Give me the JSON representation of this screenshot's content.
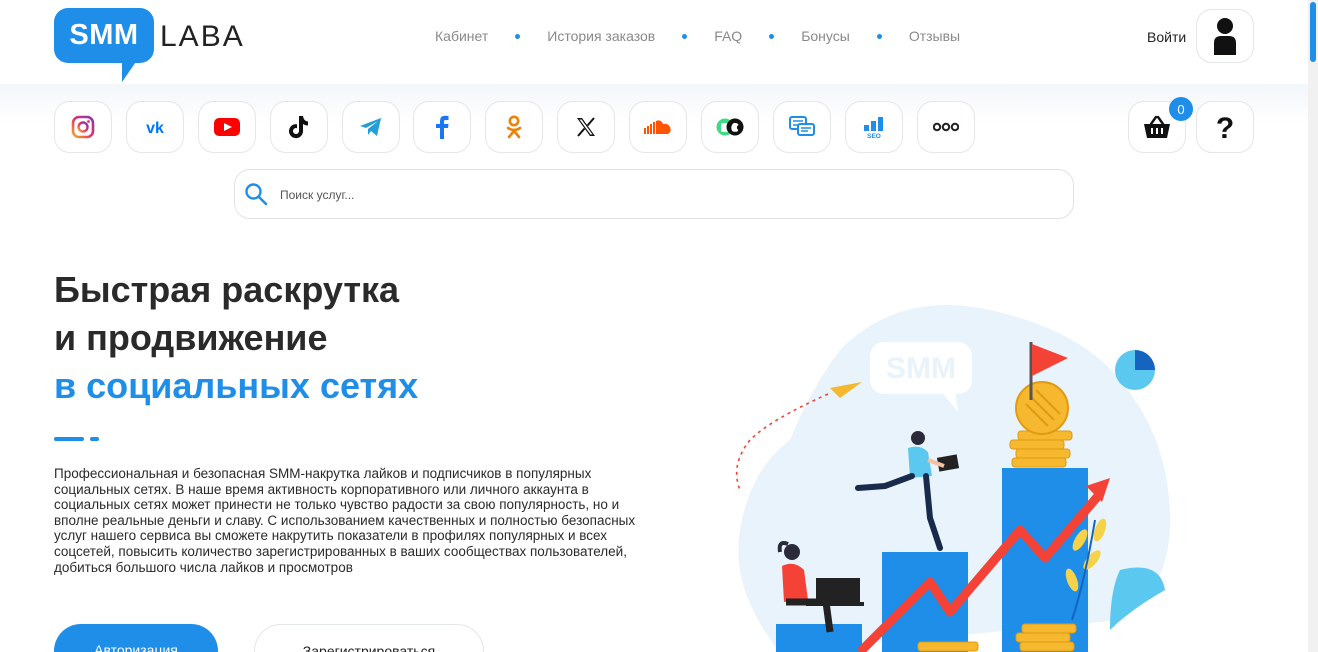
{
  "header": {
    "logo_badge": "SMM",
    "logo_text": "LABA",
    "nav": [
      "Кабинет",
      "История заказов",
      "FAQ",
      "Бонусы",
      "Отзывы"
    ],
    "login": "Войти"
  },
  "social": {
    "items": [
      {
        "icon": "instagram-icon",
        "color": "#e1306c"
      },
      {
        "icon": "vk-icon",
        "color": "#0077ff"
      },
      {
        "icon": "youtube-icon",
        "color": "#ff0000"
      },
      {
        "icon": "tiktok-icon",
        "color": "#000000"
      },
      {
        "icon": "telegram-icon",
        "color": "#229ed9"
      },
      {
        "icon": "facebook-icon",
        "color": "#1877f2"
      },
      {
        "icon": "odnoklassniki-icon",
        "color": "#ee8208"
      },
      {
        "icon": "x-icon",
        "color": "#000000"
      },
      {
        "icon": "soundcloud-icon",
        "color": "#ff5500"
      },
      {
        "icon": "android-apple-icon",
        "color": "#3ddc84"
      },
      {
        "icon": "reviews-icon",
        "color": "#1e8ee9"
      },
      {
        "icon": "seo-icon",
        "color": "#1e8ee9"
      },
      {
        "icon": "more-icon",
        "color": "#222222"
      }
    ],
    "cart_count": "0"
  },
  "search": {
    "placeholder": "Поиск услуг..."
  },
  "hero": {
    "title_line1": "Быстрая раскрутка",
    "title_line2": "и продвижение",
    "title_line3": "в социальных сетях",
    "description": "Профессиональная и безопасная SMM-накрутка лайков и подписчиков в популярных социальных сетях. В наше время активность корпоративного или личного аккаунта в социальных сетях может принести не только чувство радости за свою популярность, но и вполне реальные деньги и славу. С использованием качественных и полностью безопасных услуг нашего сервиса вы сможете накрутить показатели в профилях популярных и всех соцсетей, повысить количество зарегистрированных в ваших сообществах пользователей, добиться большого числа лайков и просмотров",
    "auth_button": "Авторизация",
    "register_button": "Зарегистрироваться",
    "illustration_badge": "SMM"
  },
  "colors": {
    "accent": "#1e8ee9",
    "title": "#2a2a2a",
    "arrow": "#f44336",
    "coin": "#f5b82e"
  }
}
